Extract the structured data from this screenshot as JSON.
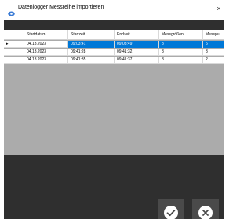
{
  "window": {
    "title": "Datenlogger Messreihe importieren",
    "close_label": "×"
  },
  "grid": {
    "columns": [
      "Startdatum",
      "Startzeit",
      "Endzeit",
      "Messgrößen",
      "Messpu"
    ],
    "rows": [
      {
        "indicator": "▸",
        "cells": [
          "04.13.2023",
          "09:03:41",
          "09:03:49",
          "8",
          "5"
        ]
      },
      {
        "indicator": "",
        "cells": [
          "04.13.2023",
          "09:41:28",
          "09:41:32",
          "8",
          "3"
        ]
      },
      {
        "indicator": "",
        "cells": [
          "04.13.2023",
          "09:41:35",
          "09:41:37",
          "8",
          "2"
        ]
      }
    ]
  },
  "scrollbar": {
    "left_arrow": "<",
    "right_arrow": ">"
  },
  "buttons": {
    "ok_icon": "check-icon",
    "cancel_icon": "x-circle-icon"
  },
  "colors": {
    "selection": "#0078d7",
    "panel": "#2f2f2f",
    "button": "#4a4a4a"
  }
}
